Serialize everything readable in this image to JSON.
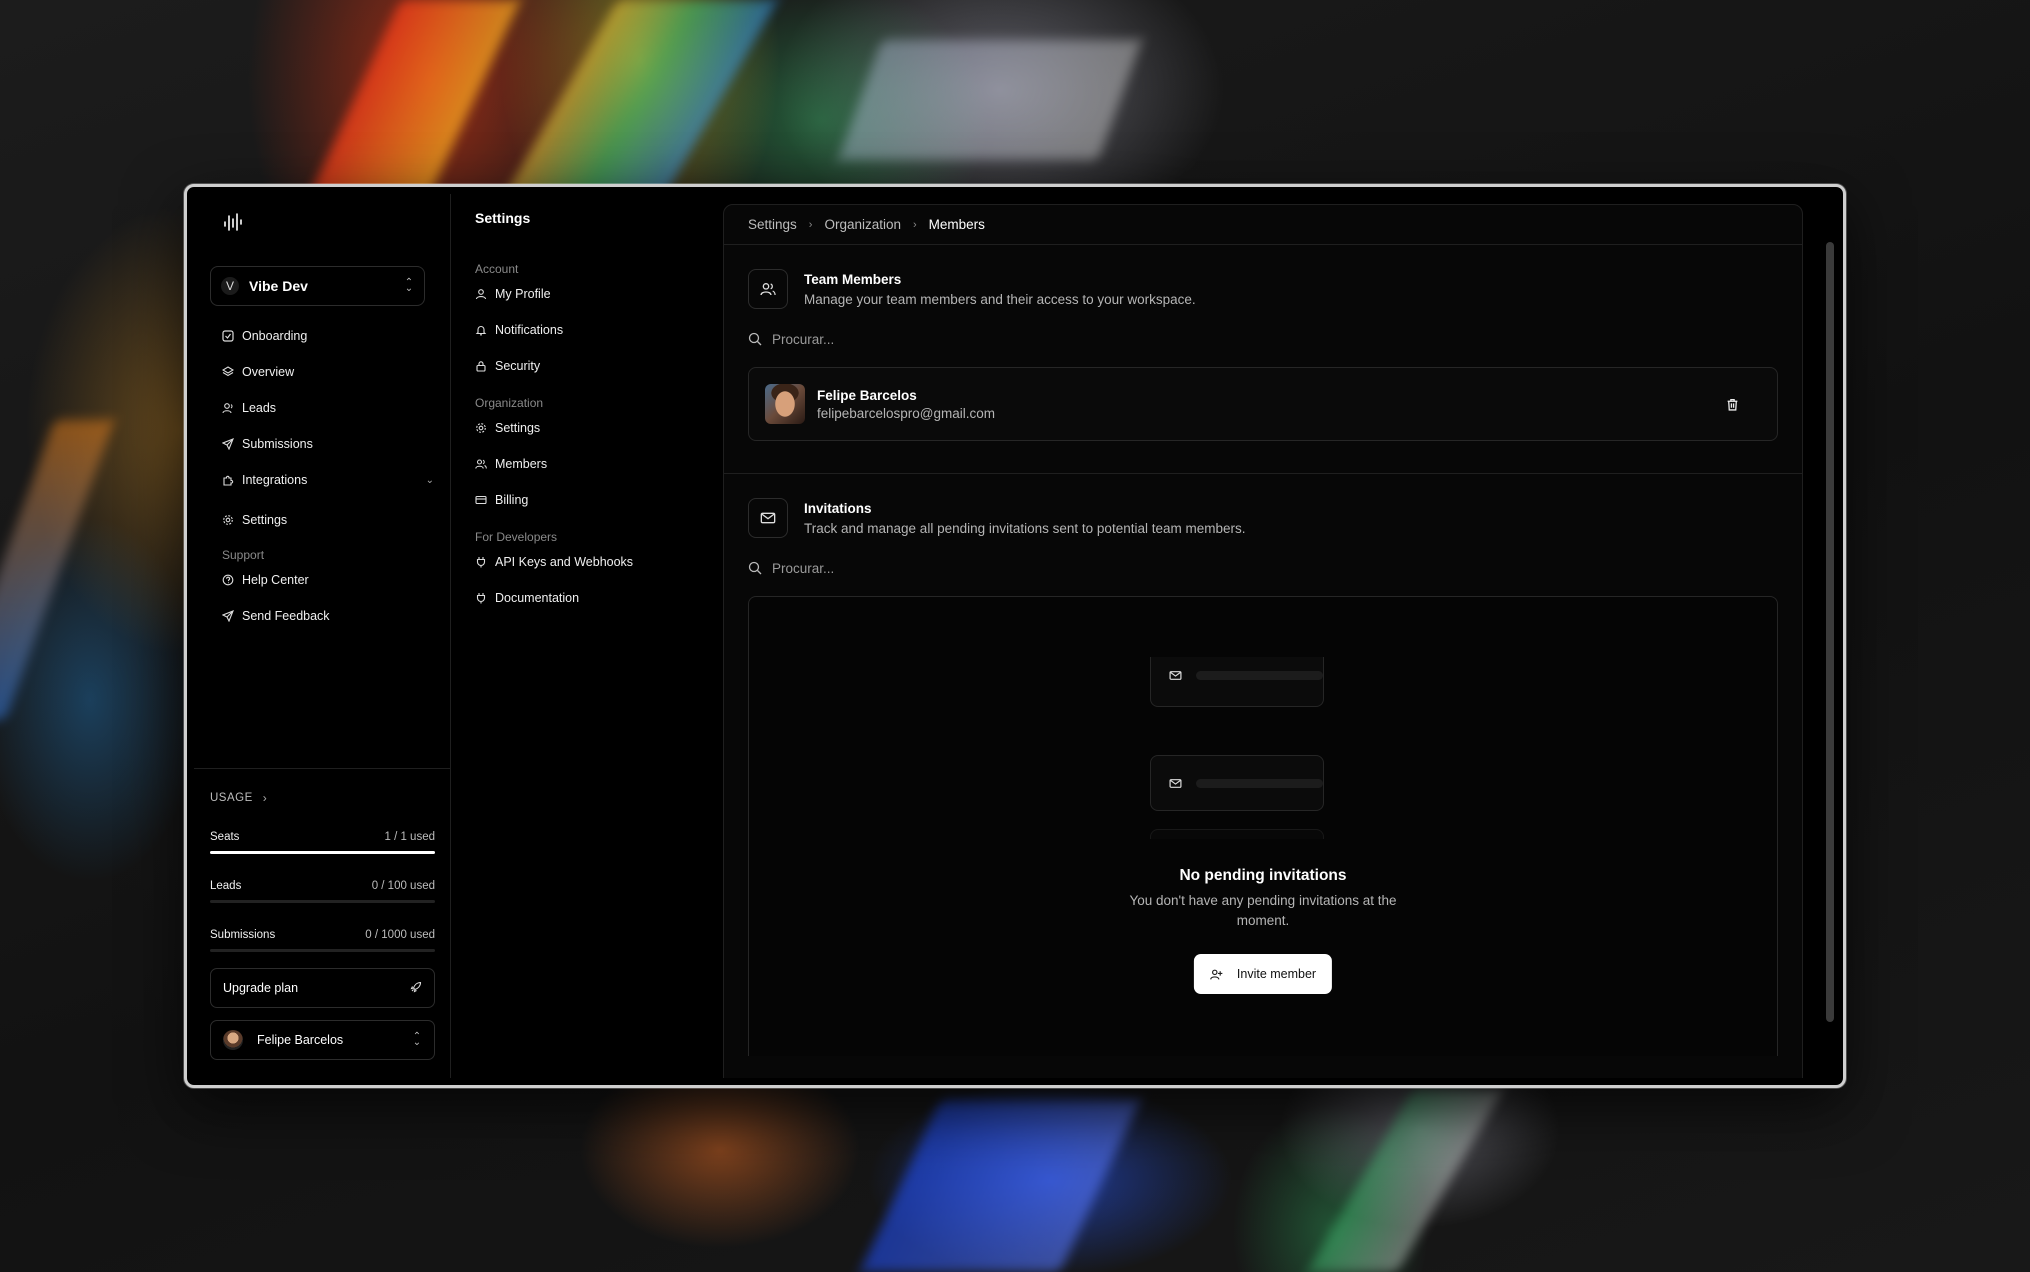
{
  "workspace": {
    "initial": "V",
    "name": "Vibe Dev"
  },
  "sidebar": {
    "items": [
      {
        "label": "Onboarding",
        "icon": "checkbox-icon"
      },
      {
        "label": "Overview",
        "icon": "layers-icon"
      },
      {
        "label": "Leads",
        "icon": "user-icon"
      },
      {
        "label": "Submissions",
        "icon": "send-icon"
      },
      {
        "label": "Integrations",
        "icon": "puzzle-icon"
      },
      {
        "label": "Settings",
        "icon": "gear-icon"
      }
    ],
    "support_label": "Support",
    "support_items": [
      {
        "label": "Help Center",
        "icon": "help-icon"
      },
      {
        "label": "Send Feedback",
        "icon": "send-icon"
      }
    ]
  },
  "usage": {
    "title": "USAGE",
    "meters": [
      {
        "label": "Seats",
        "value": "1 / 1 used",
        "fraction": 1.0
      },
      {
        "label": "Leads",
        "value": "0 / 100 used",
        "fraction": 0.0
      },
      {
        "label": "Submissions",
        "value": "0 / 1000 used",
        "fraction": 0.0
      }
    ],
    "upgrade_label": "Upgrade plan",
    "user_name": "Felipe Barcelos"
  },
  "settings_nav": {
    "title": "Settings",
    "groups": [
      {
        "label": "Account",
        "items": [
          "My Profile",
          "Notifications",
          "Security"
        ]
      },
      {
        "label": "Organization",
        "items": [
          "Settings",
          "Members",
          "Billing"
        ]
      },
      {
        "label": "For Developers",
        "items": [
          "API Keys and Webhooks",
          "Documentation"
        ]
      }
    ]
  },
  "breadcrumb": [
    "Settings",
    "Organization",
    "Members"
  ],
  "team": {
    "title": "Team Members",
    "subtitle": "Manage your team members and their access to your workspace.",
    "search_placeholder": "Procurar...",
    "members": [
      {
        "name": "Felipe Barcelos",
        "email": "felipebarcelospro@gmail.com"
      }
    ]
  },
  "invitations": {
    "title": "Invitations",
    "subtitle": "Track and manage all pending invitations sent to potential team members.",
    "search_placeholder": "Procurar...",
    "empty_title": "No pending invitations",
    "empty_subtitle": "You don't have any pending invitations at the moment.",
    "invite_label": "Invite member"
  },
  "colors": {
    "background": "#000000",
    "panel": "#070707",
    "border": "#262626",
    "accent": "#ffffff"
  }
}
